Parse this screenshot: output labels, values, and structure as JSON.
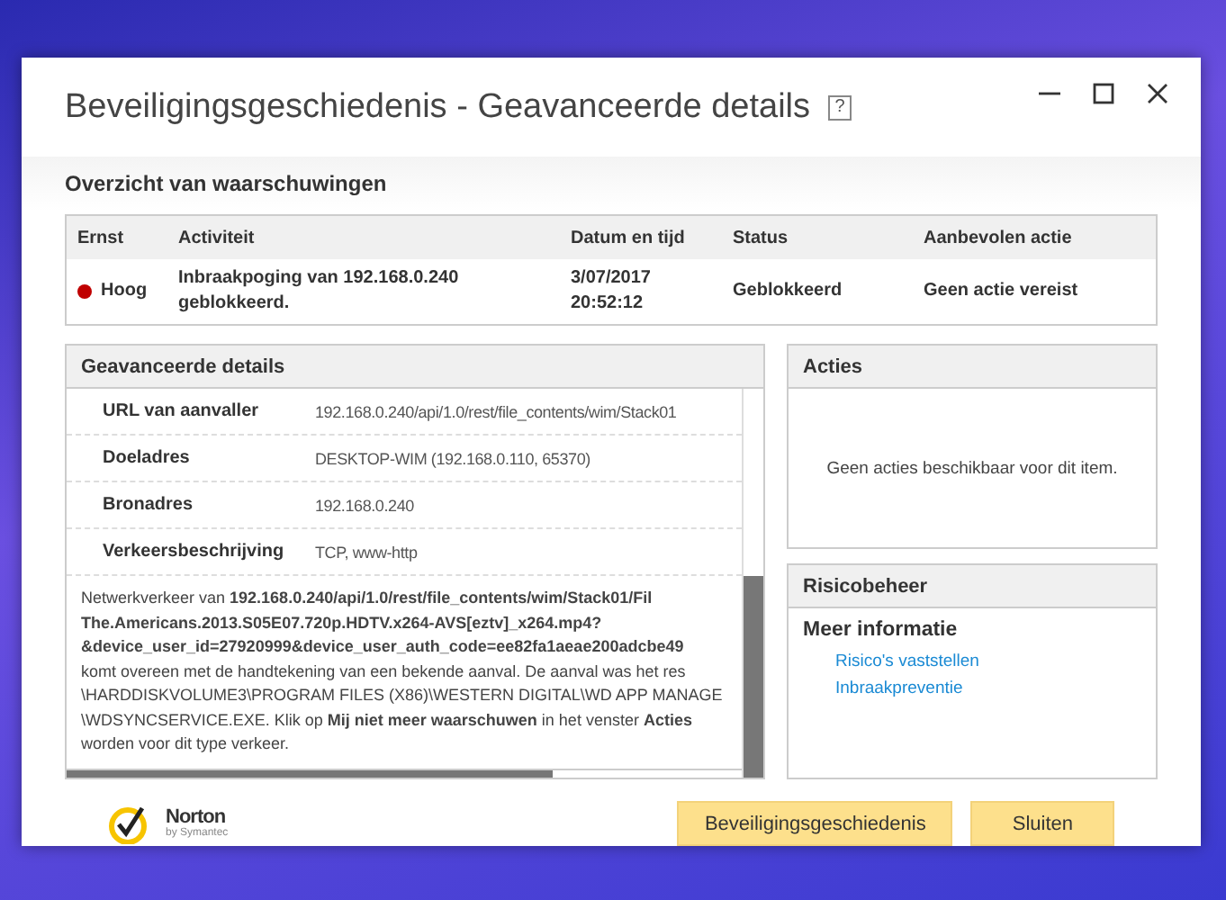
{
  "window": {
    "title": "Beveiligingsgeschiedenis - Geavanceerde details",
    "help": "?"
  },
  "overview": {
    "title": "Overzicht van waarschuwingen",
    "columns": [
      "Ernst",
      "Activiteit",
      "Datum en tijd",
      "Status",
      "Aanbevolen actie"
    ],
    "rows": [
      {
        "severity": "Hoog",
        "color": "#c00000",
        "activity": [
          "Inbraakpoging van 192.168.0.240",
          "geblokkeerd."
        ],
        "datetime": [
          "3/07/2017",
          "20:52:12"
        ],
        "status": "Geblokkeerd",
        "action": "Geen actie vereist"
      }
    ]
  },
  "details": {
    "title": "Geavanceerde details",
    "rows": [
      {
        "label": "URL van aanvaller",
        "value": "192.168.0.240/api/1.0/rest/file_contents/wim/Stack01"
      },
      {
        "label": "Doeladres",
        "value": "DESKTOP-WIM (192.168.0.110, 65370)"
      },
      {
        "label": "Bronadres",
        "value": "192.168.0.240"
      },
      {
        "label": "Verkeersbeschrijving",
        "value": "TCP, www-http"
      }
    ],
    "description": [
      "Netwerkverkeer van **192.168.0.240/api/1.0/rest/file_contents/wim/Stack01/Fil**",
      "**The.Americans.2013.S05E07.720p.HDTV.x264-AVS[eztv]_x264.mp4?**",
      "**&device_user_id=27920999&device_user_auth_code=ee82fa1aeae200adcbe49**",
      "komt overeen met de handtekening van een bekende aanval. De aanval was het res",
      "\\HARDDISKVOLUME3\\PROGRAM FILES (X86)\\WESTERN DIGITAL\\WD APP MANAGE",
      "\\WDSYNCSERVICE.EXE. Klik op **Mij niet meer waarschuwen** in het venster **Acties**",
      "worden voor dit type verkeer."
    ]
  },
  "actions": {
    "title": "Acties",
    "message": "Geen acties beschikbaar voor dit item."
  },
  "risk": {
    "title": "Risicobeheer",
    "subtitle": "Meer informatie",
    "links": [
      "Risico's vaststellen",
      "Inbraakpreventie"
    ]
  },
  "logo": {
    "name": "Norton",
    "tagline": "by Symantec"
  },
  "buttons": [
    "Beveiligingsgeschiedenis",
    "Sluiten"
  ]
}
